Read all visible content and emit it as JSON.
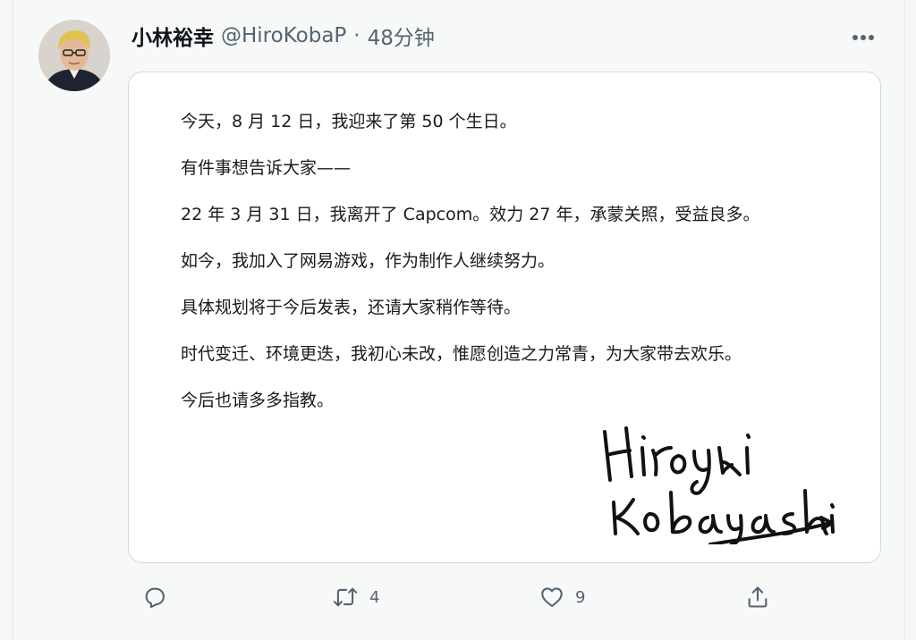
{
  "tweet": {
    "author_name": "小林裕幸",
    "handle": "@HiroKobaP",
    "separator": "·",
    "time": "48分钟",
    "more_icon": "more-horizontal-icon"
  },
  "letter": {
    "lines": [
      "今天，8 月 12 日，我迎来了第 50 个生日。",
      "有件事想告诉大家——",
      "22 年 3 月 31 日，我离开了 Capcom。效力 27 年，承蒙关照，受益良多。",
      "如今，我加入了网易游戏，作为制作人继续努力。",
      "具体规划将于今后发表，还请大家稍作等待。",
      "时代变迁、环境更迭，我初心未改，惟愿创造之力常青，为大家带去欢乐。",
      "今后也请多多指教。"
    ],
    "signature_line1": "Hiroyuki",
    "signature_line2": "Kobayashi"
  },
  "actions": {
    "reply_icon": "reply-icon",
    "retweet_icon": "retweet-icon",
    "retweet_count": "4",
    "like_icon": "heart-icon",
    "like_count": "9",
    "share_icon": "share-icon"
  },
  "colors": {
    "text_primary": "#0f1419",
    "text_secondary": "#536471",
    "border": "#cfd9de"
  }
}
